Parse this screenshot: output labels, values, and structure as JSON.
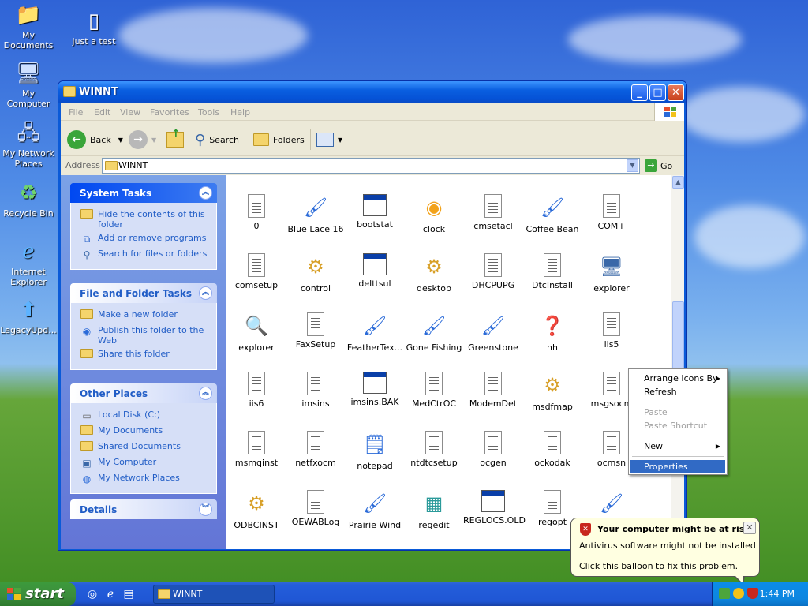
{
  "desktop": {
    "icons": [
      {
        "label": "My Documents",
        "glyph": "folder-documents-icon"
      },
      {
        "label": "just a test",
        "glyph": "text-file-icon"
      },
      {
        "label": "My Computer",
        "glyph": "computer-icon"
      },
      {
        "label": "My Network Places",
        "glyph": "network-icon"
      },
      {
        "label": "Recycle Bin",
        "glyph": "recycle-bin-icon"
      },
      {
        "label": "Internet Explorer",
        "glyph": "internet-explorer-icon"
      },
      {
        "label": "LegacyUpd...",
        "glyph": "update-arrow-icon"
      }
    ]
  },
  "window": {
    "title": "WINNT",
    "menu": [
      "File",
      "Edit",
      "View",
      "Favorites",
      "Tools",
      "Help"
    ],
    "toolbar": {
      "back": "Back",
      "search": "Search",
      "folders": "Folders"
    },
    "address": {
      "label": "Address",
      "value": "WINNT",
      "go": "Go"
    }
  },
  "tasks": {
    "system": {
      "header": "System Tasks",
      "items": [
        "Hide the contents of this folder",
        "Add or remove programs",
        "Search for files or folders"
      ]
    },
    "file_folder": {
      "header": "File and Folder Tasks",
      "items": [
        "Make a new folder",
        "Publish this folder to the Web",
        "Share this folder"
      ]
    },
    "other_places": {
      "header": "Other Places",
      "items": [
        "Local Disk (C:)",
        "My Documents",
        "Shared Documents",
        "My Computer",
        "My Network Places"
      ]
    },
    "details": {
      "header": "Details"
    }
  },
  "files": [
    {
      "name": "0",
      "type": "txt"
    },
    {
      "name": "Blue Lace 16",
      "type": "paint"
    },
    {
      "name": "bootstat",
      "type": "dat"
    },
    {
      "name": "clock",
      "type": "media"
    },
    {
      "name": "cmsetacl",
      "type": "txt"
    },
    {
      "name": "Coffee Bean",
      "type": "paint"
    },
    {
      "name": "COM+",
      "type": "txt"
    },
    {
      "name": "comsetup",
      "type": "txt"
    },
    {
      "name": "control",
      "type": "gear"
    },
    {
      "name": "delttsul",
      "type": "app"
    },
    {
      "name": "desktop",
      "type": "gear"
    },
    {
      "name": "DHCPUPG",
      "type": "txt"
    },
    {
      "name": "DtcInstall",
      "type": "txt"
    },
    {
      "name": "explorer",
      "type": "computer"
    },
    {
      "name": "explorer",
      "type": "search"
    },
    {
      "name": "FaxSetup",
      "type": "txt"
    },
    {
      "name": "FeatherTex...",
      "type": "paint"
    },
    {
      "name": "Gone Fishing",
      "type": "paint"
    },
    {
      "name": "Greenstone",
      "type": "paint"
    },
    {
      "name": "hh",
      "type": "help"
    },
    {
      "name": "iis5",
      "type": "txt"
    },
    {
      "name": "iis6",
      "type": "txt"
    },
    {
      "name": "imsins",
      "type": "txt"
    },
    {
      "name": "imsins.BAK",
      "type": "dat"
    },
    {
      "name": "MedCtrOC",
      "type": "txt"
    },
    {
      "name": "ModemDet",
      "type": "txt"
    },
    {
      "name": "msdfmap",
      "type": "gear"
    },
    {
      "name": "msgsocm",
      "type": "txt"
    },
    {
      "name": "msmqinst",
      "type": "txt"
    },
    {
      "name": "netfxocm",
      "type": "txt"
    },
    {
      "name": "notepad",
      "type": "notepad"
    },
    {
      "name": "ntdtcsetup",
      "type": "txt"
    },
    {
      "name": "ocgen",
      "type": "txt"
    },
    {
      "name": "ockodak",
      "type": "txt"
    },
    {
      "name": "ocmsn",
      "type": "txt"
    },
    {
      "name": "ODBCINST",
      "type": "gear"
    },
    {
      "name": "OEWABLog",
      "type": "txt"
    },
    {
      "name": "Prairie Wind",
      "type": "paint"
    },
    {
      "name": "regedit",
      "type": "regedit"
    },
    {
      "name": "REGLOCS.OLD",
      "type": "dat"
    },
    {
      "name": "regopt",
      "type": "txt"
    },
    {
      "name": "",
      "type": "paint"
    }
  ],
  "context_menu": {
    "items": [
      {
        "label": "Arrange Icons By",
        "submenu": true,
        "disabled": false
      },
      {
        "label": "Refresh",
        "submenu": false,
        "disabled": false
      },
      {
        "separator": true
      },
      {
        "label": "Paste",
        "submenu": false,
        "disabled": true
      },
      {
        "label": "Paste Shortcut",
        "submenu": false,
        "disabled": true
      },
      {
        "separator": true
      },
      {
        "label": "New",
        "submenu": true,
        "disabled": false
      },
      {
        "separator": true
      },
      {
        "label": "Properties",
        "submenu": false,
        "disabled": false,
        "selected": true
      }
    ]
  },
  "balloon": {
    "title": "Your computer might be at risk",
    "line1": "Antivirus software might not be installed",
    "line2": "Click this balloon to fix this problem."
  },
  "taskbar": {
    "start": "start",
    "task": "WINNT",
    "clock": "1:44 PM"
  },
  "colors": {
    "titlebar": "#0a5fe0",
    "selection": "#316ac5",
    "task_link": "#215dc6",
    "start_green": "#3b8c3b"
  }
}
